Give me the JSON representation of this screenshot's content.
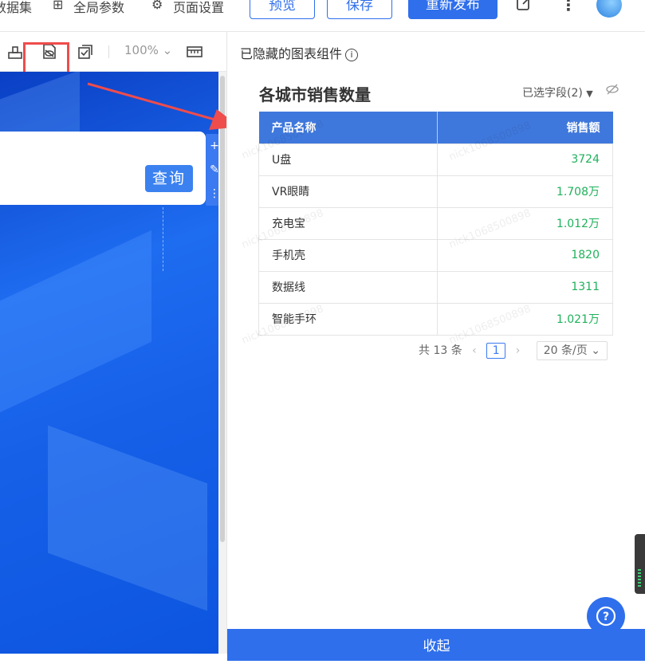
{
  "topbar": {
    "dataset_label": "数据集",
    "global_params_label": "全局参数",
    "page_settings_label": "页面设置",
    "preview_label": "预览",
    "save_label": "保存",
    "republish_label": "重新发布"
  },
  "toolbar": {
    "zoom": "100%"
  },
  "canvas": {
    "query_button": "查询"
  },
  "right_panel": {
    "header": "已隐藏的图表组件",
    "widget": {
      "title": "各城市销售数量",
      "field_select": "已选字段(2)",
      "columns": [
        "产品名称",
        "销售额"
      ],
      "rows": [
        [
          "U盘",
          "3724"
        ],
        [
          "VR眼睛",
          "1.708万"
        ],
        [
          "充电宝",
          "1.012万"
        ],
        [
          "手机壳",
          "1820"
        ],
        [
          "数据线",
          "1311"
        ],
        [
          "智能手环",
          "1.021万"
        ]
      ],
      "pager": {
        "total": "共 13 条",
        "page": "1",
        "page_size": "20 条/页"
      }
    },
    "collapse_label": "收起"
  },
  "watermark": "nick1068500898",
  "colors": {
    "primary": "#2f6fec",
    "header_bg": "#3f78dc",
    "value_green": "#1fb15b",
    "highlight_red": "#ef4c4c"
  }
}
